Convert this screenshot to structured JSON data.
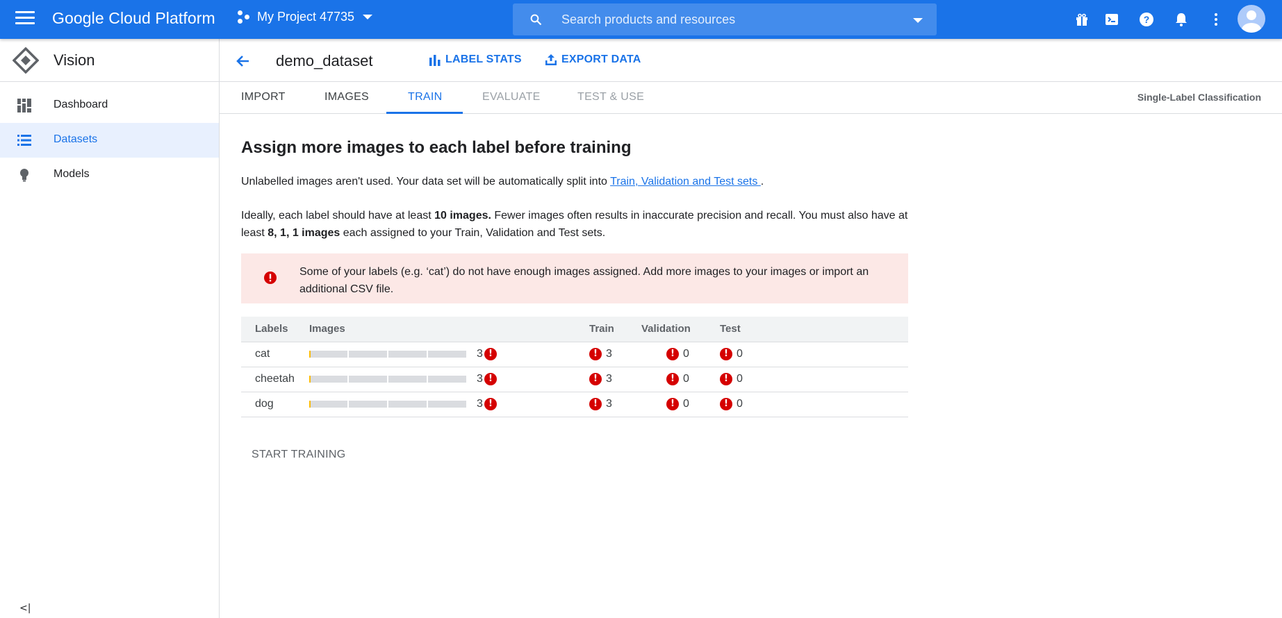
{
  "topbar": {
    "brand": "Google Cloud Platform",
    "project": "My Project 47735",
    "search_placeholder": "Search products and resources",
    "bg_color": "#1a73e8"
  },
  "sidebar": {
    "title": "Vision",
    "items": [
      {
        "label": "Dashboard",
        "icon": "dashboard-icon",
        "active": false
      },
      {
        "label": "Datasets",
        "icon": "list-icon",
        "active": true
      },
      {
        "label": "Models",
        "icon": "lightbulb-icon",
        "active": false
      }
    ],
    "collapse_label": "<|"
  },
  "header": {
    "dataset_name": "demo_dataset",
    "label_stats": "LABEL STATS",
    "export_data": "EXPORT DATA"
  },
  "tabs": {
    "items": [
      "IMPORT",
      "IMAGES",
      "TRAIN",
      "EVALUATE",
      "TEST & USE"
    ],
    "active": "TRAIN",
    "mode_label": "Single-Label Classification"
  },
  "main": {
    "heading": "Assign more images to each label before training",
    "para1_prefix": "Unlabelled images aren't used. Your data set will be automatically split into ",
    "para1_link": "Train, Validation and Test sets ",
    "para1_suffix": ".",
    "para2_a": "Ideally, each label should have at least ",
    "para2_b": "10 images.",
    "para2_c": " Fewer images often results in inaccurate precision and recall. You must also have at least ",
    "para2_d": "8, 1, 1 images",
    "para2_e": " each assigned to your Train, Validation and Test sets.",
    "alert": "Some of your labels (e.g. ‘cat’) do not have enough images assigned. Add more images to your images or import an additional CSV file.",
    "alert_color": "#fce8e6",
    "table": {
      "headers": [
        "Labels",
        "Images",
        "Train",
        "Validation",
        "Test"
      ],
      "rows": [
        {
          "label": "cat",
          "images": "3",
          "train": "3",
          "validation": "0",
          "test": "0",
          "progress": 0.01
        },
        {
          "label": "cheetah",
          "images": "3",
          "train": "3",
          "validation": "0",
          "test": "0",
          "progress": 0.01
        },
        {
          "label": "dog",
          "images": "3",
          "train": "3",
          "validation": "0",
          "test": "0",
          "progress": 0.01
        }
      ]
    },
    "start_training": "START TRAINING",
    "error_color": "#d50000"
  }
}
